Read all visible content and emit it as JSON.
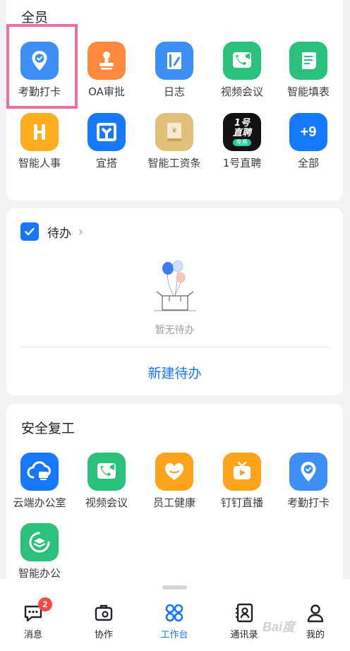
{
  "top_section": {
    "title": "全员",
    "apps": [
      {
        "label": "考勤打卡",
        "icon": "location-check-icon",
        "color": "#3d8ef7"
      },
      {
        "label": "OA审批",
        "icon": "stamp-icon",
        "color": "#ff8a3d"
      },
      {
        "label": "日志",
        "icon": "journal-icon",
        "color": "#3d8ef7"
      },
      {
        "label": "视频会议",
        "icon": "video-call-icon",
        "color": "#2cc07d"
      },
      {
        "label": "智能填表",
        "icon": "form-icon",
        "color": "#2cc07d"
      },
      {
        "label": "智能人事",
        "icon": "h-letter-icon",
        "color": "#ffad1f"
      },
      {
        "label": "宜搭",
        "icon": "yida-logo-icon",
        "color": "#1677ff"
      },
      {
        "label": "智能工资条",
        "icon": "salary-icon",
        "color": "#e1c179"
      },
      {
        "label": "1号直聘",
        "icon": "recruit-logo-icon",
        "color": "#111111"
      },
      {
        "label": "全部",
        "icon": "plus-nine-icon",
        "color": "#1677ff"
      }
    ],
    "recruit_logo": {
      "line1": "1号",
      "line2": "直聘",
      "tag": "免费"
    },
    "more_count": "+9",
    "salary_symbol": "¥"
  },
  "todo": {
    "title": "待办",
    "empty_text": "暂无待办",
    "new_button": "新建待办"
  },
  "safe_section": {
    "title": "安全复工",
    "apps": [
      {
        "label": "云端办公室",
        "icon": "cloud-computer-icon",
        "color": "#1677ff"
      },
      {
        "label": "视频会议",
        "icon": "video-call-icon",
        "color": "#2cc07d"
      },
      {
        "label": "员工健康",
        "icon": "heart-face-icon",
        "color": "#ffa31a"
      },
      {
        "label": "钉钉直播",
        "icon": "live-tv-icon",
        "color": "#ffa31a"
      },
      {
        "label": "考勤打卡",
        "icon": "location-check-icon",
        "color": "#3d8ef7"
      },
      {
        "label": "智能办公",
        "icon": "smart-office-icon",
        "color": "#2cc07d"
      }
    ]
  },
  "tabbar": {
    "tabs": [
      {
        "label": "消息",
        "icon": "chat-bubble-icon",
        "badge": "2"
      },
      {
        "label": "协作",
        "icon": "briefcase-icon"
      },
      {
        "label": "工作台",
        "icon": "grid-icon",
        "active": true
      },
      {
        "label": "通讯录",
        "icon": "contacts-icon"
      },
      {
        "label": "我的",
        "icon": "person-icon"
      }
    ]
  },
  "watermark": "Bai度"
}
